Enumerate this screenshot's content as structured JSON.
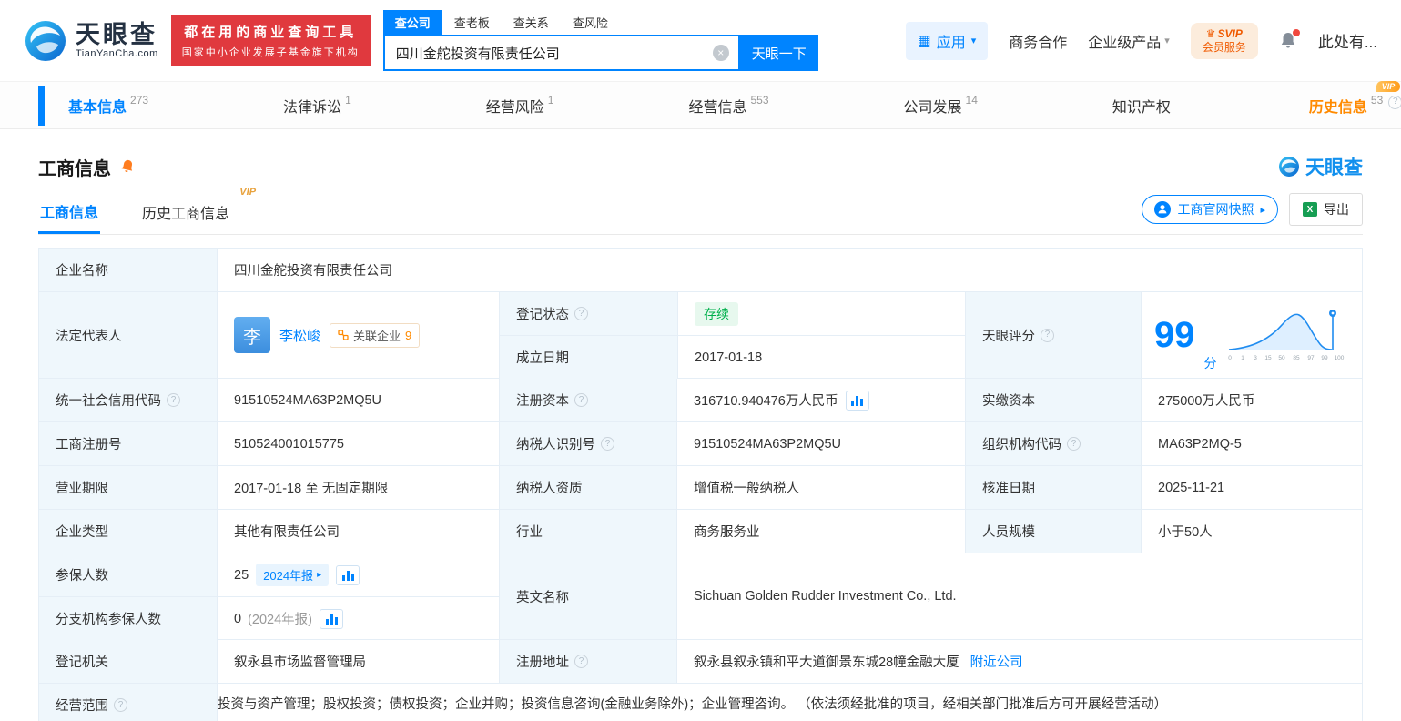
{
  "icons": {
    "help": "?",
    "caret": "▾",
    "arrow": "▸",
    "clear": "×",
    "grid": "▦",
    "crown": "♛",
    "excel": "X"
  },
  "header": {
    "brand": "天眼查",
    "brand_domain": "TianYanCha.com",
    "promo_line1": "都在用的商业查询工具",
    "promo_line2": "国家中小企业发展子基金旗下机构",
    "search_tabs": [
      {
        "label": "查公司"
      },
      {
        "label": "查老板"
      },
      {
        "label": "查关系"
      },
      {
        "label": "查风险"
      }
    ],
    "search_value": "四川金舵投资有限责任公司",
    "search_button": "天眼一下",
    "apps_label": "应用",
    "links": {
      "coop": "商务合作",
      "enterprise": "企业级产品"
    },
    "svip_line1": "SVIP",
    "svip_line2": "会员服务",
    "user": "此处有..."
  },
  "nav": {
    "tabs": [
      {
        "label": "基本信息",
        "count": "273"
      },
      {
        "label": "法律诉讼",
        "count": "1"
      },
      {
        "label": "经营风险",
        "count": "1"
      },
      {
        "label": "经营信息",
        "count": "553"
      },
      {
        "label": "公司发展",
        "count": "14"
      },
      {
        "label": "知识产权",
        "count": ""
      },
      {
        "label": "历史信息",
        "count": "53",
        "vip": "VIP"
      }
    ]
  },
  "section": {
    "title": "工商信息",
    "brand": "天眼查",
    "subtab_active": "工商信息",
    "subtab_history": "历史工商信息",
    "vip": "VIP",
    "snapshot_button": "工商官网快照",
    "export_button": "导出"
  },
  "table": {
    "company_name": {
      "label": "企业名称",
      "value": "四川金舵投资有限责任公司"
    },
    "legal_rep": {
      "label": "法定代表人",
      "avatar": "李",
      "name": "李松峻",
      "related_label": "关联企业",
      "related_count": "9"
    },
    "reg_status": {
      "label": "登记状态",
      "value": "存续"
    },
    "establish_date": {
      "label": "成立日期",
      "value": "2017-01-18"
    },
    "score": {
      "label": "天眼评分",
      "value": "99",
      "unit": "分",
      "axis": [
        "0",
        "1",
        "3",
        "15",
        "50",
        "85",
        "97",
        "99",
        "100"
      ]
    },
    "credit_code": {
      "label": "统一社会信用代码",
      "value": "91510524MA63P2MQ5U"
    },
    "reg_capital": {
      "label": "注册资本",
      "value": "316710.940476万人民币"
    },
    "paid_capital": {
      "label": "实缴资本",
      "value": "275000万人民币"
    },
    "reg_number": {
      "label": "工商注册号",
      "value": "510524001015775"
    },
    "taxpayer_id": {
      "label": "纳税人识别号",
      "value": "91510524MA63P2MQ5U"
    },
    "org_code": {
      "label": "组织机构代码",
      "value": "MA63P2MQ-5"
    },
    "business_term": {
      "label": "营业期限",
      "value": "2017-01-18 至 无固定期限"
    },
    "taxpayer_quality": {
      "label": "纳税人资质",
      "value": "增值税一般纳税人"
    },
    "approval_date": {
      "label": "核准日期",
      "value": "2025-11-21"
    },
    "company_type": {
      "label": "企业类型",
      "value": "其他有限责任公司"
    },
    "industry": {
      "label": "行业",
      "value": "商务服务业"
    },
    "staff_size": {
      "label": "人员规模",
      "value": "小于50人"
    },
    "insured_count": {
      "label": "参保人数",
      "value": "25",
      "badge": "2024年报"
    },
    "english_name": {
      "label": "英文名称",
      "value": "Sichuan Golden Rudder Investment Co., Ltd."
    },
    "branch_insured": {
      "label": "分支机构参保人数",
      "value": "0",
      "note": "(2024年报)"
    },
    "reg_authority": {
      "label": "登记机关",
      "value": "叙永县市场监督管理局"
    },
    "reg_address": {
      "label": "注册地址",
      "value": "叙永县叙永镇和平大道御景东城28幢金融大厦",
      "link": "附近公司"
    },
    "business_scope": {
      "label": "经营范围",
      "value": "投资与资产管理；股权投资；债权投资；企业并购；投资信息咨询(金融业务除外)；企业管理咨询。 （依法须经批准的项目，经相关部门批准后方可开展经营活动）"
    }
  }
}
